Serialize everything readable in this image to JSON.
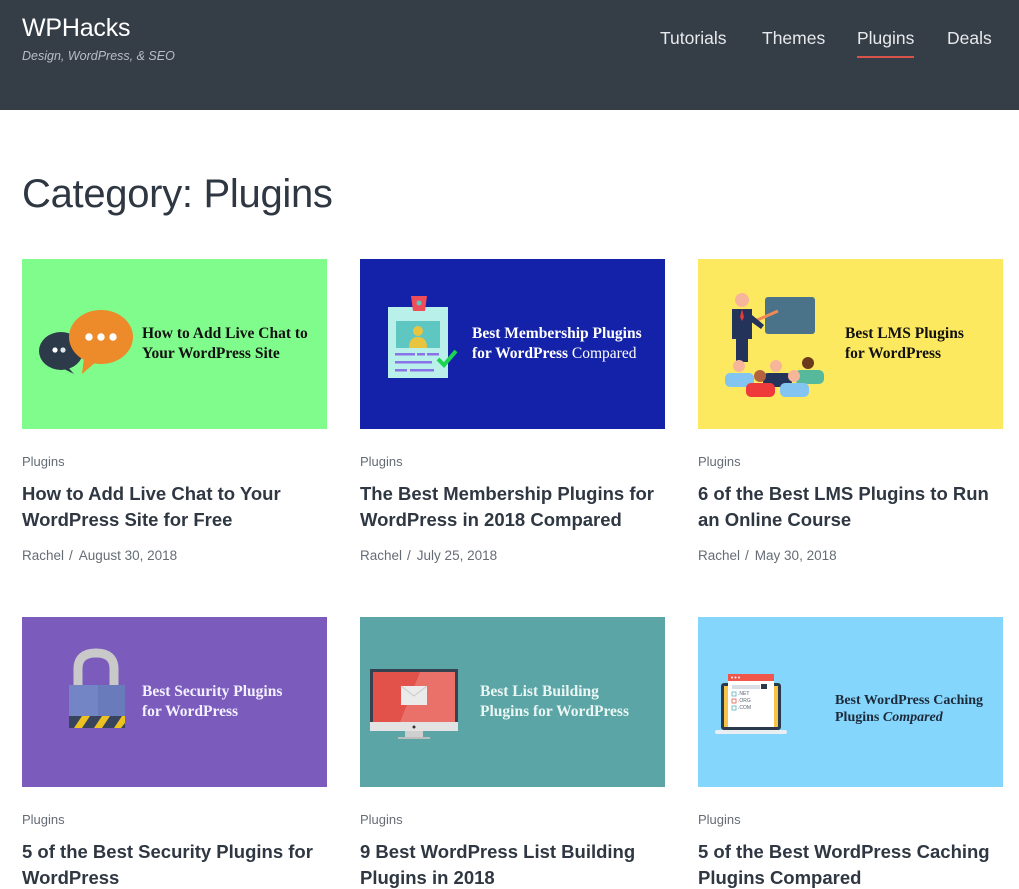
{
  "header": {
    "site_title": "WPHacks",
    "tagline": "Design, WordPress, & SEO",
    "nav": [
      {
        "label": "Tutorials",
        "active": false
      },
      {
        "label": "Themes",
        "active": false
      },
      {
        "label": "Plugins",
        "active": true
      },
      {
        "label": "Deals",
        "active": false
      }
    ],
    "accent_color": "#d9534a",
    "background_color": "#353d47"
  },
  "page": {
    "title": "Category: Plugins"
  },
  "posts": [
    {
      "thumb_bg": "#80fc8c",
      "thumb_icon": "chat-bubbles-icon",
      "thumb_lines": [
        "How to Add Live Chat to",
        "Your WordPress Site"
      ],
      "category": "Plugins",
      "title": "How to Add Live Chat to Your WordPress Site for Free",
      "author": "Rachel",
      "separator": "/",
      "date": "August 30, 2018"
    },
    {
      "thumb_bg": "#1322a8",
      "thumb_icon": "id-badge-icon",
      "thumb_lines": [
        "Best Membership Plugins",
        "for WordPress",
        " Compared"
      ],
      "category": "Plugins",
      "title": "The Best Membership Plugins for WordPress in 2018 Compared",
      "author": "Rachel",
      "separator": "/",
      "date": "July 25, 2018"
    },
    {
      "thumb_bg": "#fde95f",
      "thumb_icon": "teacher-classroom-icon",
      "thumb_lines": [
        "Best LMS Plugins",
        "for WordPress"
      ],
      "category": "Plugins",
      "title": "6 of the Best LMS Plugins to Run an Online Course",
      "author": "Rachel",
      "separator": "/",
      "date": "May 30, 2018"
    },
    {
      "thumb_bg": "#7b5cbd",
      "thumb_icon": "padlock-icon",
      "thumb_lines": [
        "Best Security Plugins",
        "for WordPress"
      ],
      "category": "Plugins",
      "title": "5 of the Best Security Plugins for WordPress"
    },
    {
      "thumb_bg": "#5ba5a6",
      "thumb_icon": "monitor-email-icon",
      "thumb_lines": [
        "Best List Building",
        "Plugins for WordPress"
      ],
      "category": "Plugins",
      "title": "9 Best WordPress List Building Plugins in 2018"
    },
    {
      "thumb_bg": "#84d6fd",
      "thumb_icon": "laptop-domains-icon",
      "thumb_lines": [
        "Best WordPress Caching",
        "Plugins ",
        "Compared"
      ],
      "thumb_domains": [
        ".NET",
        ".ORG",
        ".COM"
      ],
      "category": "Plugins",
      "title": "5 of the Best WordPress Caching Plugins Compared"
    }
  ]
}
